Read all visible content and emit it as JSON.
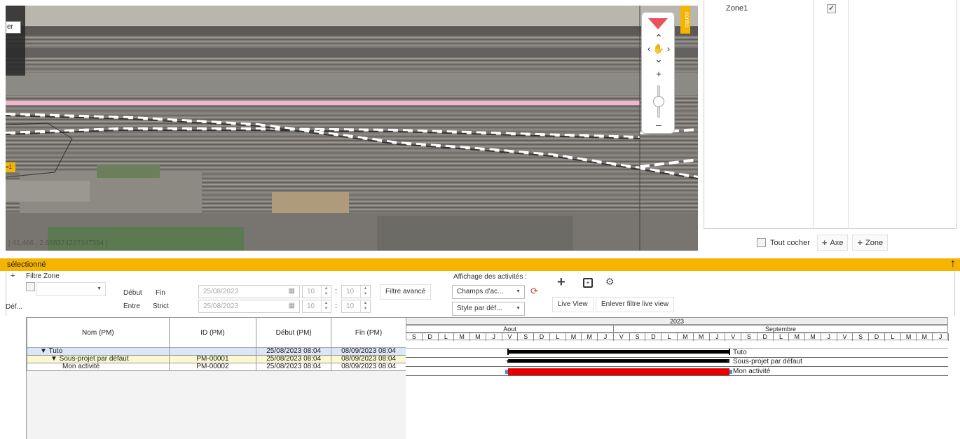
{
  "map": {
    "search_stub": "er",
    "zone_tag": "=1",
    "coordinates": "[ 41.466 , 2.68837420?347394 ]",
    "controls_tab": "contro"
  },
  "right_panel": {
    "zone_name": "Zone1",
    "zone_checked": true,
    "check_all_label": "Tout cocher",
    "add_axis_label": "Axe",
    "add_zone_label": "Zone"
  },
  "selection_bar": {
    "label": "sélectionné"
  },
  "filters": {
    "add_glyph": "+",
    "filter_zone_label": "Filtre Zone",
    "side_label": "Déf...",
    "debut_label": "Début",
    "fin_label": "Fin",
    "entre_label": "Entre",
    "strict_label": "Strict",
    "date_start": "25/08/2023",
    "date_end": "25/08/2023",
    "hour_1": "10",
    "min_1": "10",
    "hour_2": "10",
    "min_2": "10",
    "advanced_filter": "Filtre avancé",
    "activities_display_label": "Affichage des activités :",
    "fields_select": "Champs d'ac...",
    "style_select": "Style par déf...",
    "live_view": "Live View",
    "remove_live_filter": "Enlever filtre live view"
  },
  "table": {
    "columns": [
      "Nom (PM)",
      "ID (PM)",
      "Début (PM)",
      "Fin (PM)"
    ],
    "rows": [
      {
        "name": "▼ Tuto",
        "id": "",
        "start": "25/08/2023 08:04",
        "end": "08/09/2023 08:04"
      },
      {
        "name": "▼ Sous-projet par défaut",
        "id": "PM-00001",
        "start": "25/08/2023 08:04",
        "end": "08/09/2023 08:04"
      },
      {
        "name": "Mon activité",
        "id": "PM-00002",
        "start": "25/08/2023 08:04",
        "end": "08/09/2023 08:04"
      }
    ]
  },
  "gantt": {
    "year": "2023",
    "months": [
      "Aout",
      "Septembre"
    ],
    "days": [
      "S",
      "D",
      "L",
      "M",
      "M",
      "J",
      "V",
      "S",
      "D",
      "L",
      "M",
      "M",
      "J",
      "V",
      "S",
      "D",
      "L",
      "M",
      "M",
      "J",
      "V",
      "S",
      "D",
      "L",
      "M",
      "M",
      "J",
      "V",
      "S",
      "D",
      "L",
      "M",
      "M",
      "J"
    ],
    "bar_labels": [
      "Tuto",
      "Sous-projet par défaut",
      "Mon activité"
    ],
    "colors": {
      "summary": "#000000",
      "activity": "#e60000",
      "accent": "#f5b400"
    }
  }
}
